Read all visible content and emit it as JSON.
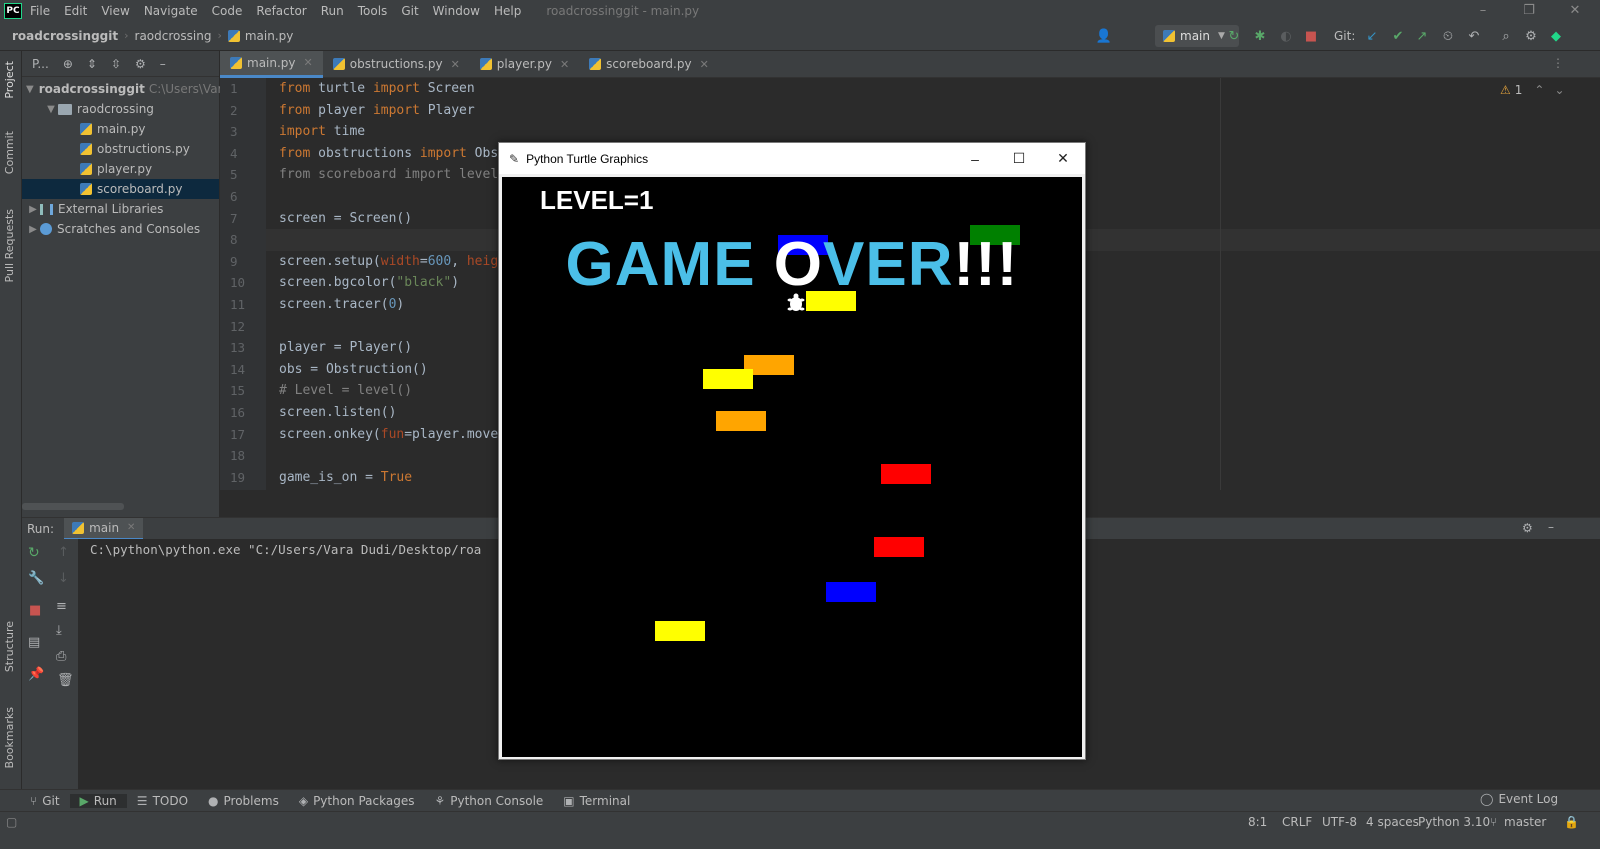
{
  "menubar": {
    "logo": "PC",
    "items": [
      "File",
      "Edit",
      "View",
      "Navigate",
      "Code",
      "Refactor",
      "Run",
      "Tools",
      "Git",
      "Window",
      "Help"
    ],
    "window_title": "roadcrossinggit - main.py"
  },
  "navbar": {
    "project": "roadcrossinggit",
    "folder": "raodcrossing",
    "file": "main.py",
    "branch": "main",
    "git_label": "Git:"
  },
  "left_strip": {
    "project": "Project",
    "commit": "Commit",
    "pull_requests": "Pull Requests",
    "structure": "Structure",
    "bookmarks": "Bookmarks"
  },
  "project_panel": {
    "header": "P...",
    "root": "roadcrossinggit",
    "root_path": "C:\\Users\\Var",
    "folder": "raodcrossing",
    "files": [
      "main.py",
      "obstructions.py",
      "player.py",
      "scoreboard.py"
    ],
    "external": "External Libraries",
    "scratches": "Scratches and Consoles"
  },
  "editor": {
    "tabs": [
      "main.py",
      "obstructions.py",
      "player.py",
      "scoreboard.py"
    ],
    "warning_count": "1",
    "line_numbers": [
      "1",
      "2",
      "3",
      "4",
      "5",
      "6",
      "7",
      "8",
      "9",
      "10",
      "11",
      "12",
      "13",
      "14",
      "15",
      "16",
      "17",
      "18",
      "19"
    ]
  },
  "code": {
    "l1a": "from",
    "l1b": " turtle ",
    "l1c": "import",
    "l1d": " Screen",
    "l2a": "from",
    "l2b": " player ",
    "l2c": "import",
    "l2d": " Player",
    "l3a": "import",
    "l3b": " time",
    "l4a": "from",
    "l4b": " obstructions ",
    "l4c": "import",
    "l4d": " Obs",
    "l5": "from scoreboard import level",
    "l7": "screen = Screen()",
    "l9a": "screen.setup(",
    "l9b": "width",
    "l9c": "=",
    "l9d": "600",
    "l9e": ", ",
    "l9f": "heig",
    "l10a": "screen.bgcolor(",
    "l10b": "\"black\"",
    "l10c": ")",
    "l11a": "screen.tracer(",
    "l11b": "0",
    "l11c": ")",
    "l13": "player = Player()",
    "l14": "obs = Obstruction()",
    "l15": "# Level = level()",
    "l16": "screen.listen()",
    "l17a": "screen.onkey(",
    "l17b": "fun",
    "l17c": "=player.move",
    "l19a": "game_is_on = ",
    "l19b": "True"
  },
  "run_panel": {
    "label": "Run:",
    "tab": "main",
    "output": "C:\\python\\python.exe \"C:/Users/Vara Dudi/Desktop/roa"
  },
  "bottom_tools": [
    "Git",
    "Run",
    "TODO",
    "Problems",
    "Python Packages",
    "Python Console",
    "Terminal"
  ],
  "event_log": "Event Log",
  "status": {
    "position": "8:1",
    "line_sep": "CRLF",
    "encoding": "UTF-8",
    "indent": "4 spaces",
    "interpreter": "Python 3.10",
    "branch": "master"
  },
  "turtle_window": {
    "title": "Python Turtle Graphics",
    "level_text": "LEVEL=1",
    "game_over_part1": "GAME ",
    "game_over_part2": "O",
    "game_over_part3": "VER",
    "game_over_part4": "!!!",
    "cars": [
      {
        "color": "#0000ff"
      },
      {
        "color": "#008000"
      },
      {
        "color": "#ffff00"
      },
      {
        "color": "#ffa500"
      },
      {
        "color": "#ffff00"
      },
      {
        "color": "#ffa500"
      },
      {
        "color": "#ff0000"
      },
      {
        "color": "#ff0000"
      },
      {
        "color": "#0000ff"
      },
      {
        "color": "#ffff00"
      }
    ]
  },
  "colors": {
    "accent": "#4a88c7",
    "game_over": "#4bbfe8"
  }
}
